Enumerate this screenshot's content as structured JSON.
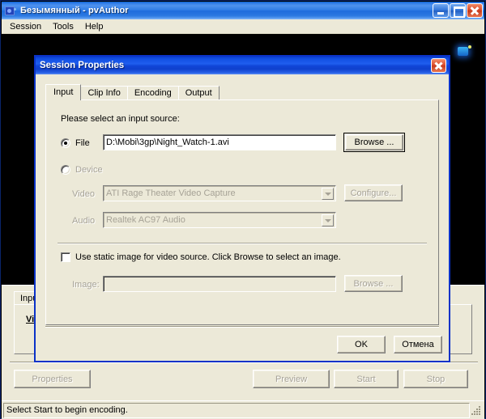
{
  "main_window": {
    "title": "Безымянный - pvAuthor",
    "icon": "camera-icon",
    "controls": {
      "minimize": "minimize-button",
      "maximize": "maximize-button",
      "close": "close-button"
    },
    "menu": [
      {
        "label": "Session"
      },
      {
        "label": "Tools"
      },
      {
        "label": "Help"
      }
    ],
    "background_tab": {
      "label": "Input"
    },
    "background_panel_label": "Video",
    "buttons": [
      {
        "label": "Properties",
        "disabled": true
      },
      {
        "label": "Preview",
        "disabled": true
      },
      {
        "label": "Start",
        "disabled": true
      },
      {
        "label": "Stop",
        "disabled": true
      }
    ],
    "statusbar": {
      "text": "Select Start to begin encoding."
    }
  },
  "dialog": {
    "title": "Session Properties",
    "close_label": "close-icon",
    "tabs": [
      {
        "label": "Input",
        "active": true
      },
      {
        "label": "Clip Info",
        "active": false
      },
      {
        "label": "Encoding",
        "active": false
      },
      {
        "label": "Output",
        "active": false
      }
    ],
    "input_tab": {
      "prompt": "Please select an input source:",
      "file_radio": {
        "label": "File",
        "checked": true
      },
      "file_path": {
        "value": "D:\\Mobi\\3gp\\Night_Watch-1.avi",
        "placeholder": ""
      },
      "file_browse": {
        "label": "Browse ...",
        "default": true
      },
      "device_radio": {
        "label": "Device",
        "checked": false
      },
      "video_label": "Video",
      "video_device": {
        "value": "ATI Rage Theater Video Capture",
        "disabled": true
      },
      "configure_button": {
        "label": "Configure...",
        "disabled": true
      },
      "audio_label": "Audio",
      "audio_device": {
        "value": "Realtek AC97 Audio",
        "disabled": true
      },
      "static_image_checkbox": {
        "label": "Use static image for video source. Click Browse to select an image.",
        "checked": false
      },
      "image_label": "Image:",
      "image_path": {
        "value": "",
        "disabled": true
      },
      "image_browse": {
        "label": "Browse ...",
        "disabled": true
      }
    },
    "ok_button": {
      "label": "OK"
    },
    "cancel_button": {
      "label": "Отмена"
    }
  },
  "colors": {
    "face": "#ece9d8",
    "active_title": "#0a32c8",
    "main_title": "#2f7ce6",
    "close_red": "#dc4c2c",
    "disabled_text": "#a6a296",
    "video_black": "#000000"
  }
}
